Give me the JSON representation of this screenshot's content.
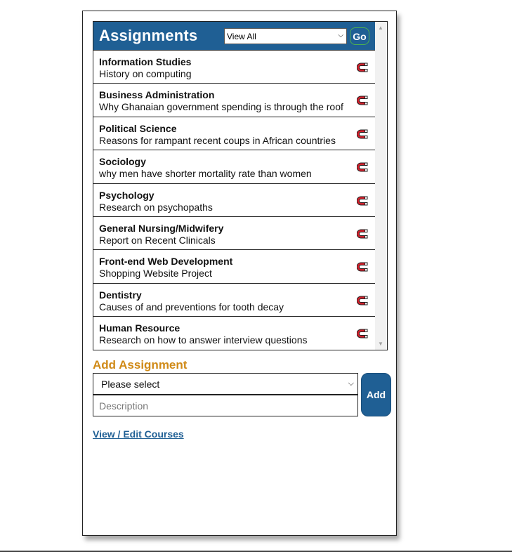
{
  "header": {
    "title": "Assignments",
    "filter_selected": "View All",
    "go_label": "Go"
  },
  "assignments": [
    {
      "course": "Information Studies",
      "description": "History on computing"
    },
    {
      "course": "Business Administration",
      "description": "Why Ghanaian government spending is through the roof"
    },
    {
      "course": "Political Science",
      "description": "Reasons for rampant recent coups in African countries"
    },
    {
      "course": "Sociology",
      "description": "why men have shorter mortality rate than women"
    },
    {
      "course": "Psychology",
      "description": "Research on psychopaths"
    },
    {
      "course": "General Nursing/Midwifery",
      "description": "Report on Recent Clinicals"
    },
    {
      "course": "Front-end Web Development",
      "description": "Shopping Website Project"
    },
    {
      "course": "Dentistry",
      "description": "Causes of and preventions for tooth decay"
    },
    {
      "course": "Human Resource",
      "description": "Research on how to answer interview questions"
    }
  ],
  "add_form": {
    "heading": "Add Assignment",
    "course_selected": "Please select",
    "description_placeholder": "Description",
    "add_label": "Add"
  },
  "links": {
    "view_edit_courses": "View / Edit Courses"
  },
  "icons": {
    "delete": "magnet-icon"
  },
  "colors": {
    "header_bg": "#1f5f94",
    "heading_accent": "#d08a17",
    "magnet_red": "#d11f2b"
  }
}
